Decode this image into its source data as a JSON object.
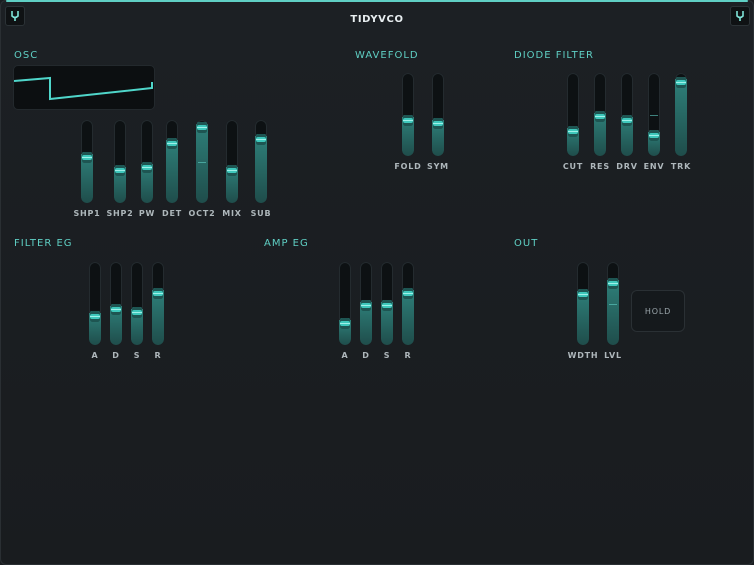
{
  "app": {
    "title": "TIDYVCO"
  },
  "sections": {
    "osc": "OSC",
    "wavefold": "WAVEFOLD",
    "diode_filter": "DIODE FILTER",
    "filter_eg": "FILTER EG",
    "amp_eg": "AMP EG",
    "out": "OUT"
  },
  "controls": {
    "osc": [
      {
        "label": "SHP1",
        "value": 0.62
      },
      {
        "label": "SHP2",
        "value": 0.45
      },
      {
        "label": "PW",
        "value": 0.5
      },
      {
        "label": "DET",
        "value": 0.8
      },
      {
        "label": "OCT2",
        "value": 1.0,
        "center": true
      },
      {
        "label": "MIX",
        "value": 0.45
      },
      {
        "label": "SUB",
        "value": 0.85
      }
    ],
    "wavefold": [
      {
        "label": "FOLD",
        "value": 0.5
      },
      {
        "label": "SYM",
        "value": 0.45
      }
    ],
    "diode_filter": [
      {
        "label": "CUT",
        "value": 0.35
      },
      {
        "label": "RES",
        "value": 0.55
      },
      {
        "label": "DRV",
        "value": 0.5
      },
      {
        "label": "ENV",
        "value": 0.3,
        "center": true
      },
      {
        "label": "TRK",
        "value": 0.97
      }
    ],
    "filter_eg": [
      {
        "label": "A",
        "value": 0.4
      },
      {
        "label": "D",
        "value": 0.5
      },
      {
        "label": "S",
        "value": 0.45
      },
      {
        "label": "R",
        "value": 0.7
      }
    ],
    "amp_eg": [
      {
        "label": "A",
        "value": 0.32
      },
      {
        "label": "D",
        "value": 0.55
      },
      {
        "label": "S",
        "value": 0.55
      },
      {
        "label": "R",
        "value": 0.7
      }
    ],
    "out": [
      {
        "label": "WDTH",
        "value": 0.68
      },
      {
        "label": "LVL",
        "value": 0.82,
        "center": true
      }
    ]
  },
  "hold_label": "HOLD",
  "colors": {
    "accent": "#5fcfc4",
    "background": "#1a1d20"
  },
  "icons": {
    "left_logo": "tuning-fork-icon",
    "right_logo": "tuning-fork-icon"
  }
}
